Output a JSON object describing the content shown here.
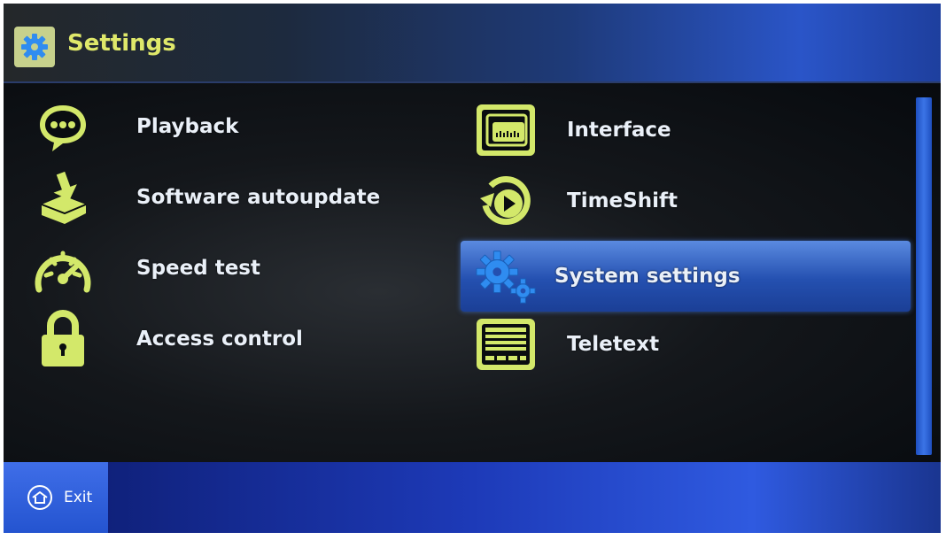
{
  "header": {
    "title": "Settings",
    "icon": "gear-icon"
  },
  "menu": {
    "left": [
      {
        "label": "Playback",
        "icon": "speech-bubble-icon"
      },
      {
        "label": "Software autoupdate",
        "icon": "download-box-icon"
      },
      {
        "label": "Speed test",
        "icon": "speedometer-icon"
      },
      {
        "label": "Access control",
        "icon": "lock-icon"
      }
    ],
    "right": [
      {
        "label": "Interface",
        "icon": "interface-screen-icon"
      },
      {
        "label": "TimeShift",
        "icon": "timeshift-play-icon"
      },
      {
        "label": "System settings",
        "icon": "gears-icon",
        "selected": true
      },
      {
        "label": "Teletext",
        "icon": "teletext-icon"
      }
    ]
  },
  "footer": {
    "exit_label": "Exit",
    "exit_icon": "home-icon"
  },
  "colors": {
    "accent_icon": "#d3e86a",
    "title": "#dfe86a",
    "selection": "#2d5fd0",
    "gear_blue": "#2f8cf0"
  }
}
